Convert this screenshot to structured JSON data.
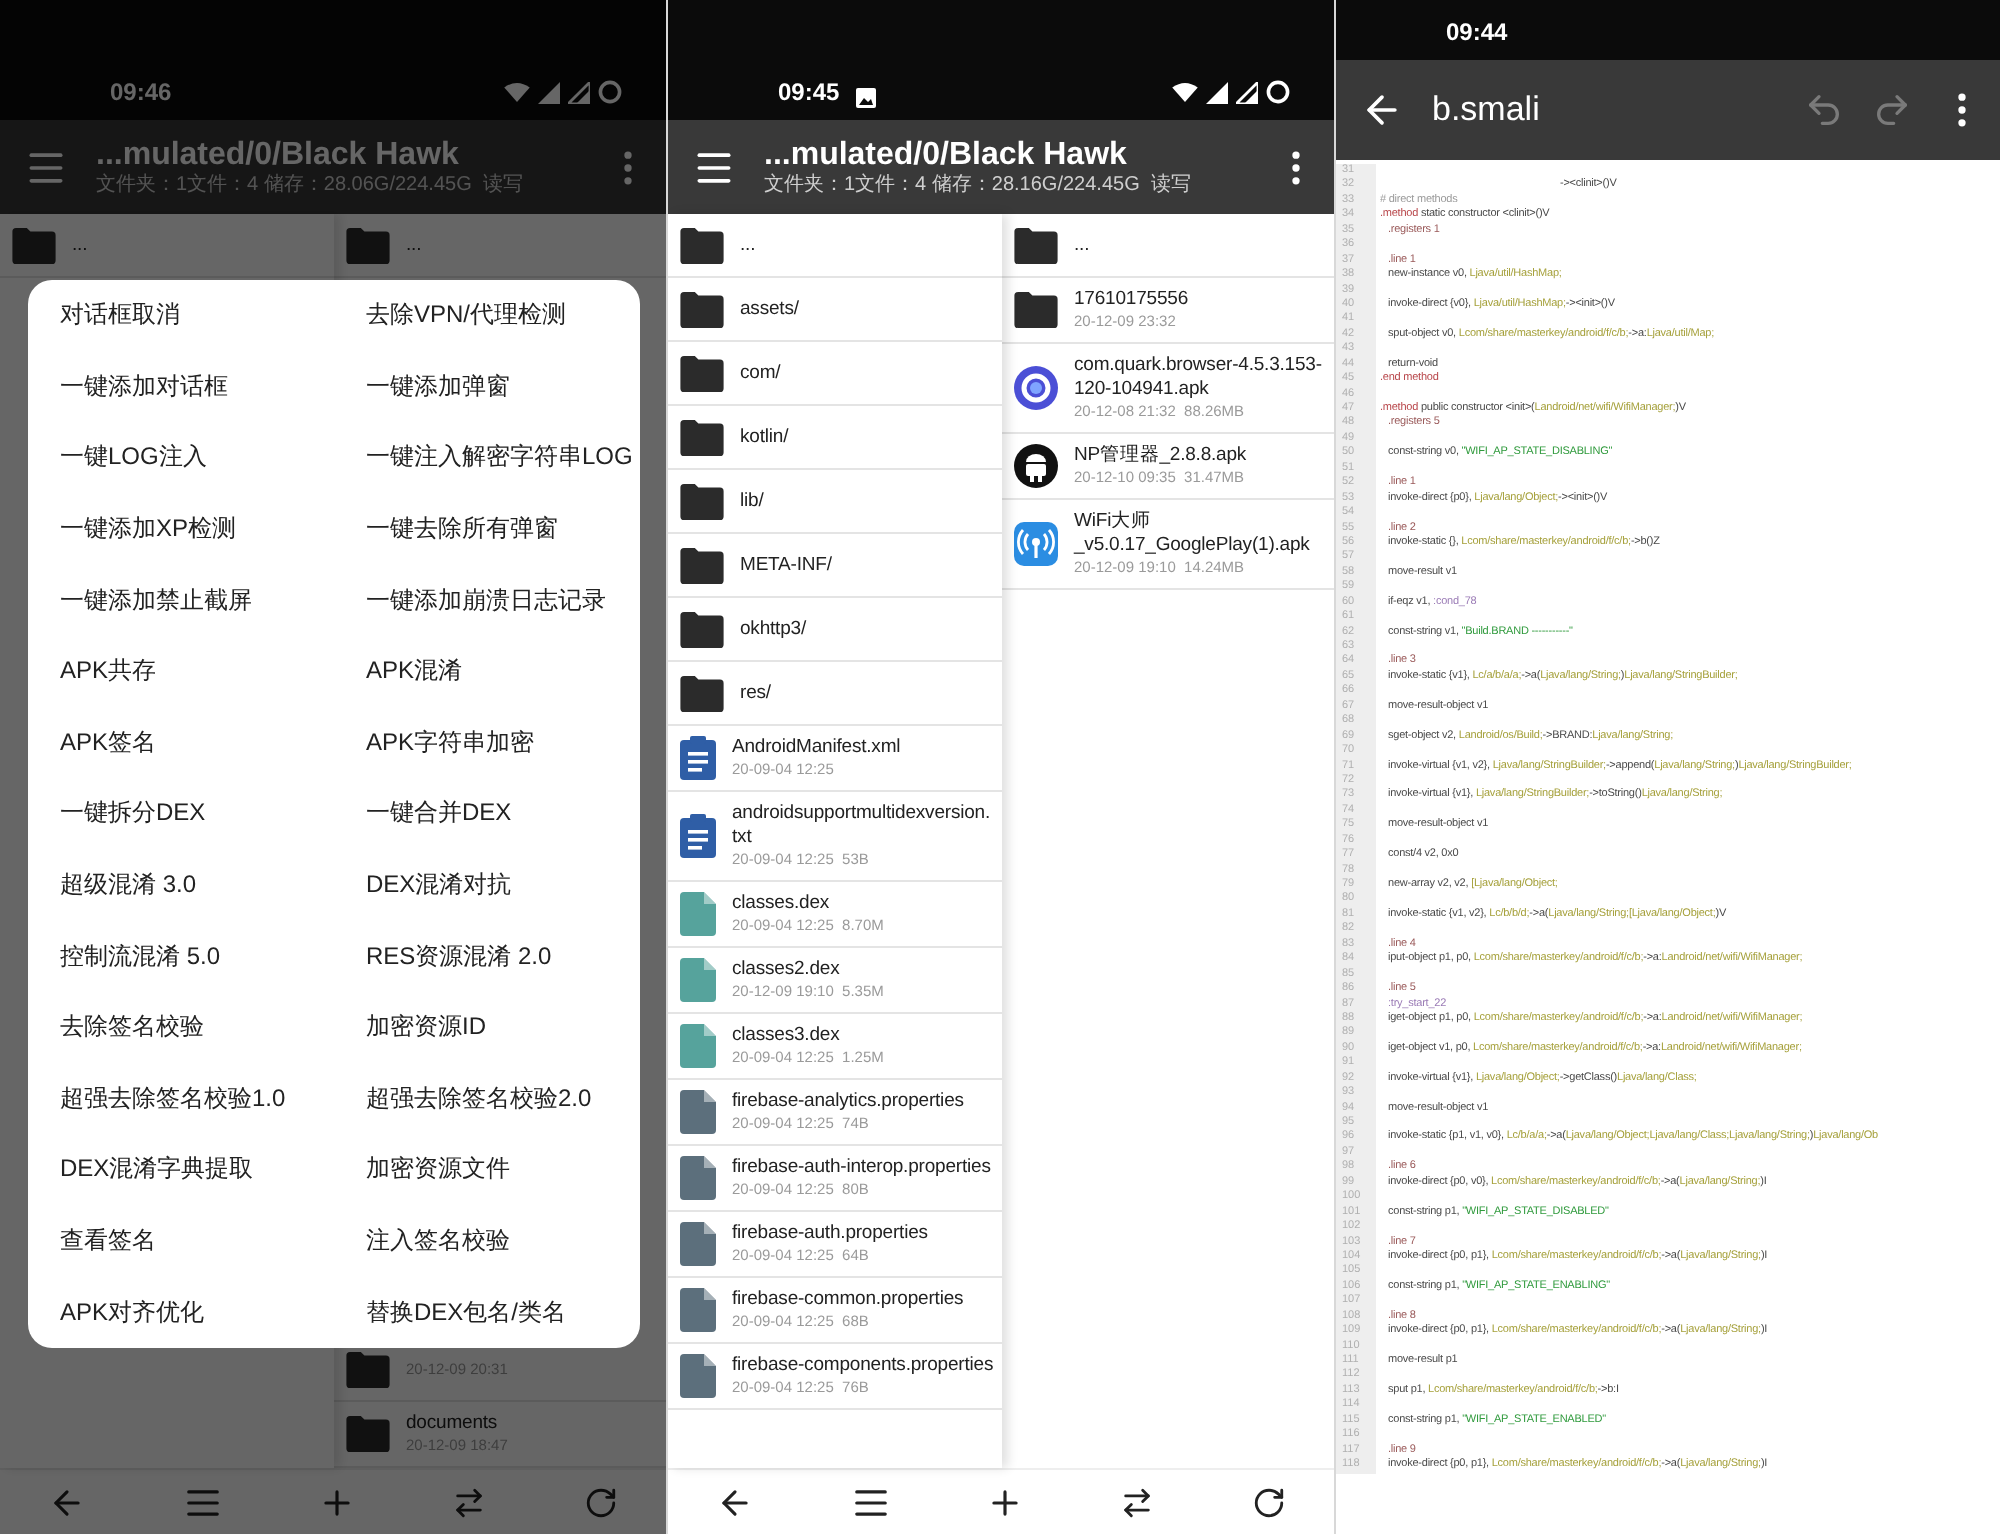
{
  "screens": [
    {
      "status_bar": {
        "time": "09:46",
        "image_notification": false
      },
      "app_bar": {
        "title": "...mulated/0/Black Hawk",
        "subtitle": "文件夹：1文件：4 储存：28.06G/224.45G  读写"
      },
      "columns": [
        {
          "items": [
            {
              "kind": "folder",
              "name": "..."
            }
          ]
        },
        {
          "items": [
            {
              "kind": "folder",
              "name": "..."
            }
          ],
          "end_items": [
            {
              "kind": "folder",
              "meta": "20-12-09 20:31"
            },
            {
              "kind": "folder",
              "name": "documents",
              "meta": "20-12-09 18:47"
            }
          ]
        }
      ],
      "dialog": {
        "options": [
          "对话框取消",
          "去除VPN/代理检测",
          "一键添加对话框",
          "一键添加弹窗",
          "一键LOG注入",
          "一键注入解密字符串LOG",
          "一键添加XP检测",
          "一键去除所有弹窗",
          "一键添加禁止截屏",
          "一键添加崩溃日志记录",
          "APK共存",
          "APK混淆",
          "APK签名",
          "APK字符串加密",
          "一键拆分DEX",
          "一键合并DEX",
          "超级混淆 3.0",
          "DEX混淆对抗",
          "控制流混淆 5.0",
          "RES资源混淆 2.0",
          "去除签名校验",
          "加密资源ID",
          "超强去除签名校验1.0",
          "超强去除签名校验2.0",
          "DEX混淆字典提取",
          "加密资源文件",
          "查看签名",
          "注入签名校验",
          "APK对齐优化",
          "替换DEX包名/类名"
        ]
      }
    },
    {
      "status_bar": {
        "time": "09:45",
        "image_notification": true
      },
      "app_bar": {
        "title": "...mulated/0/Black Hawk",
        "subtitle": "文件夹：1文件：4 储存：28.16G/224.45G  读写"
      },
      "columns": [
        {
          "items": [
            {
              "kind": "folder",
              "name": "..."
            },
            {
              "kind": "folder",
              "name": "assets/"
            },
            {
              "kind": "folder",
              "name": "com/"
            },
            {
              "kind": "folder",
              "name": "kotlin/"
            },
            {
              "kind": "folder",
              "name": "lib/"
            },
            {
              "kind": "folder",
              "name": "META-INF/"
            },
            {
              "kind": "folder",
              "name": "okhttp3/"
            },
            {
              "kind": "folder",
              "name": "res/"
            },
            {
              "kind": "document",
              "name": "AndroidManifest.xml",
              "meta": "20-09-04 12:25"
            },
            {
              "kind": "document",
              "name": "androidsupportmultidexversion.txt",
              "meta": "20-09-04 12:25  53B"
            },
            {
              "kind": "dex",
              "name": "classes.dex",
              "meta": "20-09-04 12:25  8.70M"
            },
            {
              "kind": "dex",
              "name": "classes2.dex",
              "meta": "20-12-09 19:10  5.35M"
            },
            {
              "kind": "dex",
              "name": "classes3.dex",
              "meta": "20-09-04 12:25  1.25M"
            },
            {
              "kind": "properties",
              "name": "firebase-analytics.properties",
              "meta": "20-09-04 12:25  74B"
            },
            {
              "kind": "properties",
              "name": "firebase-auth-interop.properties",
              "meta": "20-09-04 12:25  80B"
            },
            {
              "kind": "properties",
              "name": "firebase-auth.properties",
              "meta": "20-09-04 12:25  64B"
            },
            {
              "kind": "properties",
              "name": "firebase-common.properties",
              "meta": "20-09-04 12:25  68B"
            },
            {
              "kind": "properties",
              "name": "firebase-components.properties",
              "meta": "20-09-04 12:25  76B"
            }
          ]
        },
        {
          "items": [
            {
              "kind": "folder",
              "name": "..."
            },
            {
              "kind": "folder",
              "name": "17610175556",
              "meta": "20-12-09 23:32"
            },
            {
              "kind": "ring-app",
              "name": "com.quark.browser-4.5.3.153-120-104941.apk",
              "meta": "20-12-08 21:32  88.26MB"
            },
            {
              "kind": "robot-app",
              "name": "NP管理器_2.8.8.apk",
              "meta": "20-12-10 09:35  31.47MB"
            },
            {
              "kind": "wifi-app",
              "name": "WiFi大师_v5.0.17_GooglePlay(1).apk",
              "meta": "20-12-09 19:10  14.24MB"
            }
          ]
        }
      ]
    }
  ],
  "editor": {
    "status_bar": {
      "time": "09:44"
    },
    "title": "b.smali",
    "lines": [
      {
        "no": "31"
      },
      {
        "no": "32",
        "kind": "wrap",
        "code": [
          {
            "kind": "op",
            "text": "-><clinit>()V"
          }
        ]
      },
      {
        "no": "33",
        "kind": "header",
        "code": [
          {
            "kind": "comment",
            "text": "# direct methods"
          }
        ]
      },
      {
        "no": "34",
        "kind": "header",
        "code": [
          {
            "kind": "kw",
            "text": ".method"
          },
          {
            "kind": "op",
            "text": " static constructor <clinit>()V"
          }
        ]
      },
      {
        "no": "35",
        "kind": "body",
        "code": [
          {
            "kind": "dir",
            "text": ".registers 1"
          }
        ]
      },
      {
        "no": "36"
      },
      {
        "no": "37",
        "kind": "body",
        "code": [
          {
            "kind": "dir",
            "text": ".line 1"
          }
        ]
      },
      {
        "no": "38",
        "kind": "body",
        "code": [
          {
            "kind": "op",
            "text": "new-instance v0, "
          },
          {
            "kind": "type",
            "text": "Ljava/util/HashMap;"
          }
        ]
      },
      {
        "no": "39"
      },
      {
        "no": "40",
        "kind": "body",
        "code": [
          {
            "kind": "op",
            "text": "invoke-direct {v0}, "
          },
          {
            "kind": "type",
            "text": "Ljava/util/HashMap;"
          },
          {
            "kind": "op",
            "text": "-><init>()V"
          }
        ]
      },
      {
        "no": "41"
      },
      {
        "no": "42",
        "kind": "body",
        "code": [
          {
            "kind": "op",
            "text": "sput-object v0, "
          },
          {
            "kind": "type",
            "text": "Lcom/share/masterkey/android/f/c/b;"
          },
          {
            "kind": "op",
            "text": "->a:"
          },
          {
            "kind": "type",
            "text": "Ljava/util/Map;"
          }
        ]
      },
      {
        "no": "43"
      },
      {
        "no": "44",
        "kind": "body",
        "code": [
          {
            "kind": "op",
            "text": "return-void"
          }
        ]
      },
      {
        "no": "45",
        "kind": "header",
        "code": [
          {
            "kind": "kw",
            "text": ".end method"
          }
        ]
      },
      {
        "no": "46"
      },
      {
        "no": "47",
        "kind": "header",
        "code": [
          {
            "kind": "kw",
            "text": ".method"
          },
          {
            "kind": "op",
            "text": " public constructor <init>("
          },
          {
            "kind": "type",
            "text": "Landroid/net/wifi/WifiManager;"
          },
          {
            "kind": "op",
            "text": ")V"
          }
        ]
      },
      {
        "no": "48",
        "kind": "body",
        "code": [
          {
            "kind": "dir",
            "text": ".registers 5"
          }
        ]
      },
      {
        "no": "49"
      },
      {
        "no": "50",
        "kind": "body",
        "code": [
          {
            "kind": "op",
            "text": "const-string v0, "
          },
          {
            "kind": "str",
            "text": "\"WIFI_AP_STATE_DISABLING\""
          }
        ]
      },
      {
        "no": "51"
      },
      {
        "no": "52",
        "kind": "body",
        "code": [
          {
            "kind": "dir",
            "text": ".line 1"
          }
        ]
      },
      {
        "no": "53",
        "kind": "body",
        "code": [
          {
            "kind": "op",
            "text": "invoke-direct {p0}, "
          },
          {
            "kind": "type",
            "text": "Ljava/lang/Object;"
          },
          {
            "kind": "op",
            "text": "-><init>()V"
          }
        ]
      },
      {
        "no": "54"
      },
      {
        "no": "55",
        "kind": "body",
        "code": [
          {
            "kind": "dir",
            "text": ".line 2"
          }
        ]
      },
      {
        "no": "56",
        "kind": "body",
        "code": [
          {
            "kind": "op",
            "text": "invoke-static {}, "
          },
          {
            "kind": "type",
            "text": "Lcom/share/masterkey/android/f/c/b;"
          },
          {
            "kind": "op",
            "text": "->b()Z"
          }
        ]
      },
      {
        "no": "57"
      },
      {
        "no": "58",
        "kind": "body",
        "code": [
          {
            "kind": "op",
            "text": "move-result v1"
          }
        ]
      },
      {
        "no": "59"
      },
      {
        "no": "60",
        "kind": "body",
        "code": [
          {
            "kind": "op",
            "text": "if-eqz v1, "
          },
          {
            "kind": "label",
            "text": ":cond_78"
          }
        ]
      },
      {
        "no": "61"
      },
      {
        "no": "62",
        "kind": "body",
        "code": [
          {
            "kind": "op",
            "text": "const-string v1, "
          },
          {
            "kind": "str",
            "text": "\"Build.BRAND -----------\""
          }
        ]
      },
      {
        "no": "63"
      },
      {
        "no": "64",
        "kind": "body",
        "code": [
          {
            "kind": "dir",
            "text": ".line 3"
          }
        ]
      },
      {
        "no": "65",
        "kind": "body",
        "code": [
          {
            "kind": "op",
            "text": "invoke-static {v1}, "
          },
          {
            "kind": "type",
            "text": "Lc/a/b/a/a;"
          },
          {
            "kind": "op",
            "text": "->a("
          },
          {
            "kind": "type",
            "text": "Ljava/lang/String;"
          },
          {
            "kind": "op",
            "text": ")"
          },
          {
            "kind": "type",
            "text": "Ljava/lang/StringBuilder;"
          }
        ]
      },
      {
        "no": "66"
      },
      {
        "no": "67",
        "kind": "body",
        "code": [
          {
            "kind": "op",
            "text": "move-result-object v1"
          }
        ]
      },
      {
        "no": "68"
      },
      {
        "no": "69",
        "kind": "body",
        "code": [
          {
            "kind": "op",
            "text": "sget-object v2, "
          },
          {
            "kind": "type",
            "text": "Landroid/os/Build;"
          },
          {
            "kind": "op",
            "text": "->BRAND:"
          },
          {
            "kind": "type",
            "text": "Ljava/lang/String;"
          }
        ]
      },
      {
        "no": "70"
      },
      {
        "no": "71",
        "kind": "body",
        "code": [
          {
            "kind": "op",
            "text": "invoke-virtual {v1, v2}, "
          },
          {
            "kind": "type",
            "text": "Ljava/lang/StringBuilder;"
          },
          {
            "kind": "op",
            "text": "->append("
          },
          {
            "kind": "type",
            "text": "Ljava/lang/String;"
          },
          {
            "kind": "op",
            "text": ")"
          },
          {
            "kind": "type",
            "text": "Ljava/lang/StringBuilder;"
          }
        ]
      },
      {
        "no": "72"
      },
      {
        "no": "73",
        "kind": "body",
        "code": [
          {
            "kind": "op",
            "text": "invoke-virtual {v1}, "
          },
          {
            "kind": "type",
            "text": "Ljava/lang/StringBuilder;"
          },
          {
            "kind": "op",
            "text": "->toString()"
          },
          {
            "kind": "type",
            "text": "Ljava/lang/String;"
          }
        ]
      },
      {
        "no": "74"
      },
      {
        "no": "75",
        "kind": "body",
        "code": [
          {
            "kind": "op",
            "text": "move-result-object v1"
          }
        ]
      },
      {
        "no": "76"
      },
      {
        "no": "77",
        "kind": "body",
        "code": [
          {
            "kind": "op",
            "text": "const/4 v2, 0x0"
          }
        ]
      },
      {
        "no": "78"
      },
      {
        "no": "79",
        "kind": "body",
        "code": [
          {
            "kind": "op",
            "text": "new-array v2, v2, "
          },
          {
            "kind": "type",
            "text": "[Ljava/lang/Object;"
          }
        ]
      },
      {
        "no": "80"
      },
      {
        "no": "81",
        "kind": "body",
        "code": [
          {
            "kind": "op",
            "text": "invoke-static {v1, v2}, "
          },
          {
            "kind": "type",
            "text": "Lc/b/b/d;"
          },
          {
            "kind": "op",
            "text": "->a("
          },
          {
            "kind": "type",
            "text": "Ljava/lang/String;[Ljava/lang/Object;"
          },
          {
            "kind": "op",
            "text": ")V"
          }
        ]
      },
      {
        "no": "82"
      },
      {
        "no": "83",
        "kind": "body",
        "code": [
          {
            "kind": "dir",
            "text": ".line 4"
          }
        ]
      },
      {
        "no": "84",
        "kind": "body",
        "code": [
          {
            "kind": "op",
            "text": "iput-object p1, p0, "
          },
          {
            "kind": "type",
            "text": "Lcom/share/masterkey/android/f/c/b;"
          },
          {
            "kind": "op",
            "text": "->a:"
          },
          {
            "kind": "type",
            "text": "Landroid/net/wifi/WifiManager;"
          }
        ]
      },
      {
        "no": "85"
      },
      {
        "no": "86",
        "kind": "body",
        "code": [
          {
            "kind": "dir",
            "text": ".line 5"
          }
        ]
      },
      {
        "no": "87",
        "kind": "body",
        "code": [
          {
            "kind": "label",
            "text": ":try_start_22"
          }
        ]
      },
      {
        "no": "88",
        "kind": "body",
        "code": [
          {
            "kind": "op",
            "text": "iget-object p1, p0, "
          },
          {
            "kind": "type",
            "text": "Lcom/share/masterkey/android/f/c/b;"
          },
          {
            "kind": "op",
            "text": "->a:"
          },
          {
            "kind": "type",
            "text": "Landroid/net/wifi/WifiManager;"
          }
        ]
      },
      {
        "no": "89"
      },
      {
        "no": "90",
        "kind": "body",
        "code": [
          {
            "kind": "op",
            "text": "iget-object v1, p0, "
          },
          {
            "kind": "type",
            "text": "Lcom/share/masterkey/android/f/c/b;"
          },
          {
            "kind": "op",
            "text": "->a:"
          },
          {
            "kind": "type",
            "text": "Landroid/net/wifi/WifiManager;"
          }
        ]
      },
      {
        "no": "91"
      },
      {
        "no": "92",
        "kind": "body",
        "code": [
          {
            "kind": "op",
            "text": "invoke-virtual {v1}, "
          },
          {
            "kind": "type",
            "text": "Ljava/lang/Object;"
          },
          {
            "kind": "op",
            "text": "->getClass()"
          },
          {
            "kind": "type",
            "text": "Ljava/lang/Class;"
          }
        ]
      },
      {
        "no": "93"
      },
      {
        "no": "94",
        "kind": "body",
        "code": [
          {
            "kind": "op",
            "text": "move-result-object v1"
          }
        ]
      },
      {
        "no": "95"
      },
      {
        "no": "96",
        "kind": "body",
        "code": [
          {
            "kind": "op",
            "text": "invoke-static {p1, v1, v0}, "
          },
          {
            "kind": "type",
            "text": "Lc/b/a/a;"
          },
          {
            "kind": "op",
            "text": "->a("
          },
          {
            "kind": "type",
            "text": "Ljava/lang/Object;Ljava/lang/Class;Ljava/lang/String;"
          },
          {
            "kind": "op",
            "text": ")"
          },
          {
            "kind": "type",
            "text": "Ljava/lang/Ob"
          }
        ]
      },
      {
        "no": "97"
      },
      {
        "no": "98",
        "kind": "body",
        "code": [
          {
            "kind": "dir",
            "text": ".line 6"
          }
        ]
      },
      {
        "no": "99",
        "kind": "body",
        "code": [
          {
            "kind": "op",
            "text": "invoke-direct {p0, v0}, "
          },
          {
            "kind": "type",
            "text": "Lcom/share/masterkey/android/f/c/b;"
          },
          {
            "kind": "op",
            "text": "->a("
          },
          {
            "kind": "type",
            "text": "Ljava/lang/String;"
          },
          {
            "kind": "op",
            "text": ")I"
          }
        ]
      },
      {
        "no": "100"
      },
      {
        "no": "101",
        "kind": "body",
        "code": [
          {
            "kind": "op",
            "text": "const-string p1, "
          },
          {
            "kind": "str",
            "text": "\"WIFI_AP_STATE_DISABLED\""
          }
        ]
      },
      {
        "no": "102"
      },
      {
        "no": "103",
        "kind": "body",
        "code": [
          {
            "kind": "dir",
            "text": ".line 7"
          }
        ]
      },
      {
        "no": "104",
        "kind": "body",
        "code": [
          {
            "kind": "op",
            "text": "invoke-direct {p0, p1}, "
          },
          {
            "kind": "type",
            "text": "Lcom/share/masterkey/android/f/c/b;"
          },
          {
            "kind": "op",
            "text": "->a("
          },
          {
            "kind": "type",
            "text": "Ljava/lang/String;"
          },
          {
            "kind": "op",
            "text": ")I"
          }
        ]
      },
      {
        "no": "105"
      },
      {
        "no": "106",
        "kind": "body",
        "code": [
          {
            "kind": "op",
            "text": "const-string p1, "
          },
          {
            "kind": "str",
            "text": "\"WIFI_AP_STATE_ENABLING\""
          }
        ]
      },
      {
        "no": "107"
      },
      {
        "no": "108",
        "kind": "body",
        "code": [
          {
            "kind": "dir",
            "text": ".line 8"
          }
        ]
      },
      {
        "no": "109",
        "kind": "body",
        "code": [
          {
            "kind": "op",
            "text": "invoke-direct {p0, p1}, "
          },
          {
            "kind": "type",
            "text": "Lcom/share/masterkey/android/f/c/b;"
          },
          {
            "kind": "op",
            "text": "->a("
          },
          {
            "kind": "type",
            "text": "Ljava/lang/String;"
          },
          {
            "kind": "op",
            "text": ")I"
          }
        ]
      },
      {
        "no": "110"
      },
      {
        "no": "111",
        "kind": "body",
        "code": [
          {
            "kind": "op",
            "text": "move-result p1"
          }
        ]
      },
      {
        "no": "112"
      },
      {
        "no": "113",
        "kind": "body",
        "code": [
          {
            "kind": "op",
            "text": "sput p1, "
          },
          {
            "kind": "type",
            "text": "Lcom/share/masterkey/android/f/c/b;"
          },
          {
            "kind": "op",
            "text": "->b:I"
          }
        ]
      },
      {
        "no": "114"
      },
      {
        "no": "115",
        "kind": "body",
        "code": [
          {
            "kind": "op",
            "text": "const-string p1, "
          },
          {
            "kind": "str",
            "text": "\"WIFI_AP_STATE_ENABLED\""
          }
        ]
      },
      {
        "no": "116"
      },
      {
        "no": "117",
        "kind": "body",
        "code": [
          {
            "kind": "dir",
            "text": ".line 9"
          }
        ]
      },
      {
        "no": "118",
        "kind": "body",
        "code": [
          {
            "kind": "op",
            "text": "invoke-direct {p0, p1}, "
          },
          {
            "kind": "type",
            "text": "Lcom/share/masterkey/android/f/c/b;"
          },
          {
            "kind": "op",
            "text": "->a("
          },
          {
            "kind": "type",
            "text": "Ljava/lang/String;"
          },
          {
            "kind": "op",
            "text": ")I"
          }
        ]
      }
    ]
  }
}
